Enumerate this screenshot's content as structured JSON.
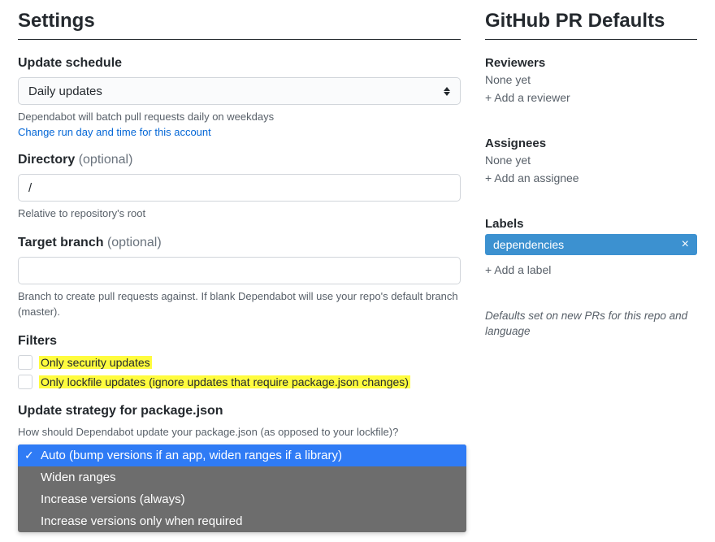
{
  "settings": {
    "title": "Settings",
    "update_schedule": {
      "label": "Update schedule",
      "selected": "Daily updates",
      "help": "Dependabot will batch pull requests daily on weekdays",
      "link": "Change run day and time for this account"
    },
    "directory": {
      "label": "Directory ",
      "optional": "(optional)",
      "value": "/",
      "help": "Relative to repository's root"
    },
    "target_branch": {
      "label": "Target branch ",
      "optional": "(optional)",
      "value": "",
      "help": "Branch to create pull requests against. If blank Dependabot will use your repo's default branch (master)."
    },
    "filters": {
      "label": "Filters",
      "security": "Only security updates",
      "lockfile": "Only lockfile updates (ignore updates that require package.json changes)"
    },
    "strategy": {
      "label": "Update strategy for package.json",
      "help": "How should Dependabot update your package.json (as opposed to your lockfile)?",
      "options": [
        "Auto (bump versions if an app, widen ranges if a library)",
        "Widen ranges",
        "Increase versions (always)",
        "Increase versions only when required"
      ]
    }
  },
  "defaults": {
    "title": "GitHub PR Defaults",
    "reviewers": {
      "label": "Reviewers",
      "none": "None yet",
      "add": "+ Add a reviewer"
    },
    "assignees": {
      "label": "Assignees",
      "none": "None yet",
      "add": "+ Add an assignee"
    },
    "labels": {
      "label": "Labels",
      "chip": "dependencies",
      "add": "+ Add a label"
    },
    "note": "Defaults set on new PRs for this repo and language"
  }
}
